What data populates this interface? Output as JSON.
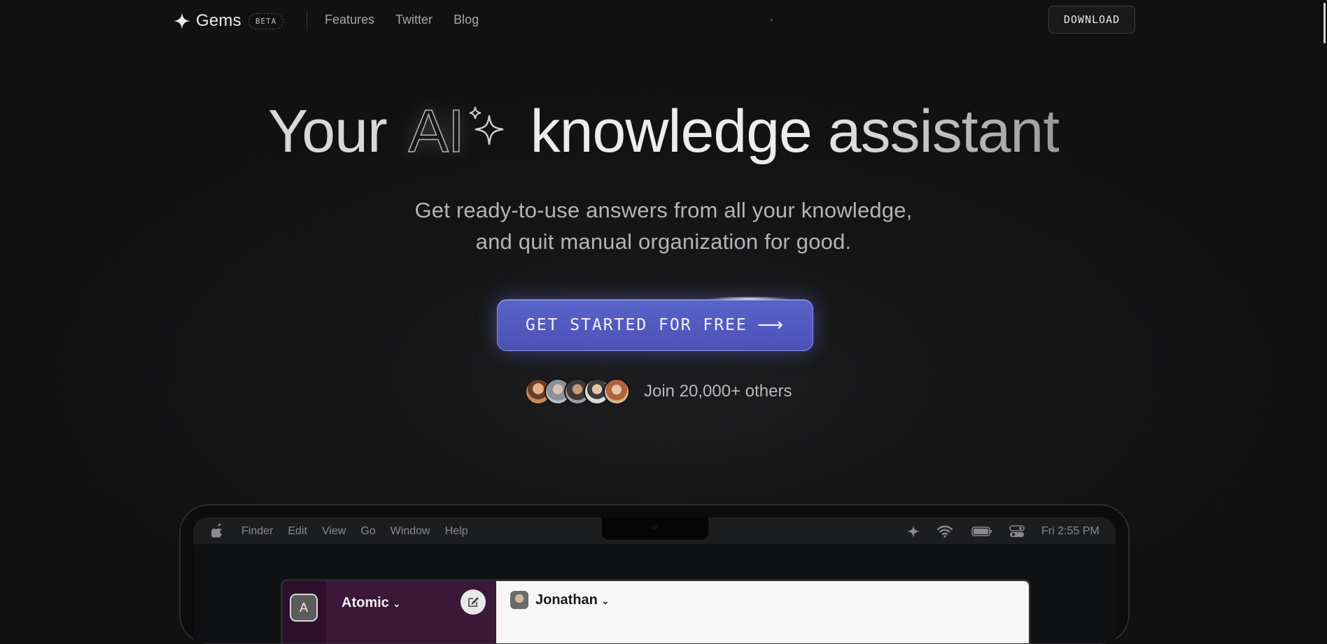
{
  "nav": {
    "brand": "Gems",
    "badge": "BETA",
    "links": [
      "Features",
      "Twitter",
      "Blog"
    ],
    "download_label": "DOWNLOAD"
  },
  "hero": {
    "headline": {
      "w1": "Your",
      "w2": "AI",
      "w3": "knowledge",
      "w4": "assistant"
    },
    "subtitle_line1": "Get ready-to-use answers from all your knowledge,",
    "subtitle_line2": "and quit manual organization for good.",
    "cta_label": "GET STARTED FOR FREE",
    "cta_arrow": "⟶",
    "social_proof": "Join 20,000+ others"
  },
  "colors": {
    "cta": "#5059c0",
    "background": "#141415",
    "app_sidebar": "#3b1738"
  },
  "mac": {
    "menus": [
      "Finder",
      "Edit",
      "View",
      "Go",
      "Window",
      "Help"
    ],
    "status_icons": [
      "sparkle-icon",
      "wifi-icon",
      "battery-icon",
      "control-center-icon"
    ],
    "clock": "Fri 2:55 PM"
  },
  "app": {
    "workspace_initial": "A",
    "workspace_name": "Atomic",
    "chat_user": "Jonathan"
  }
}
